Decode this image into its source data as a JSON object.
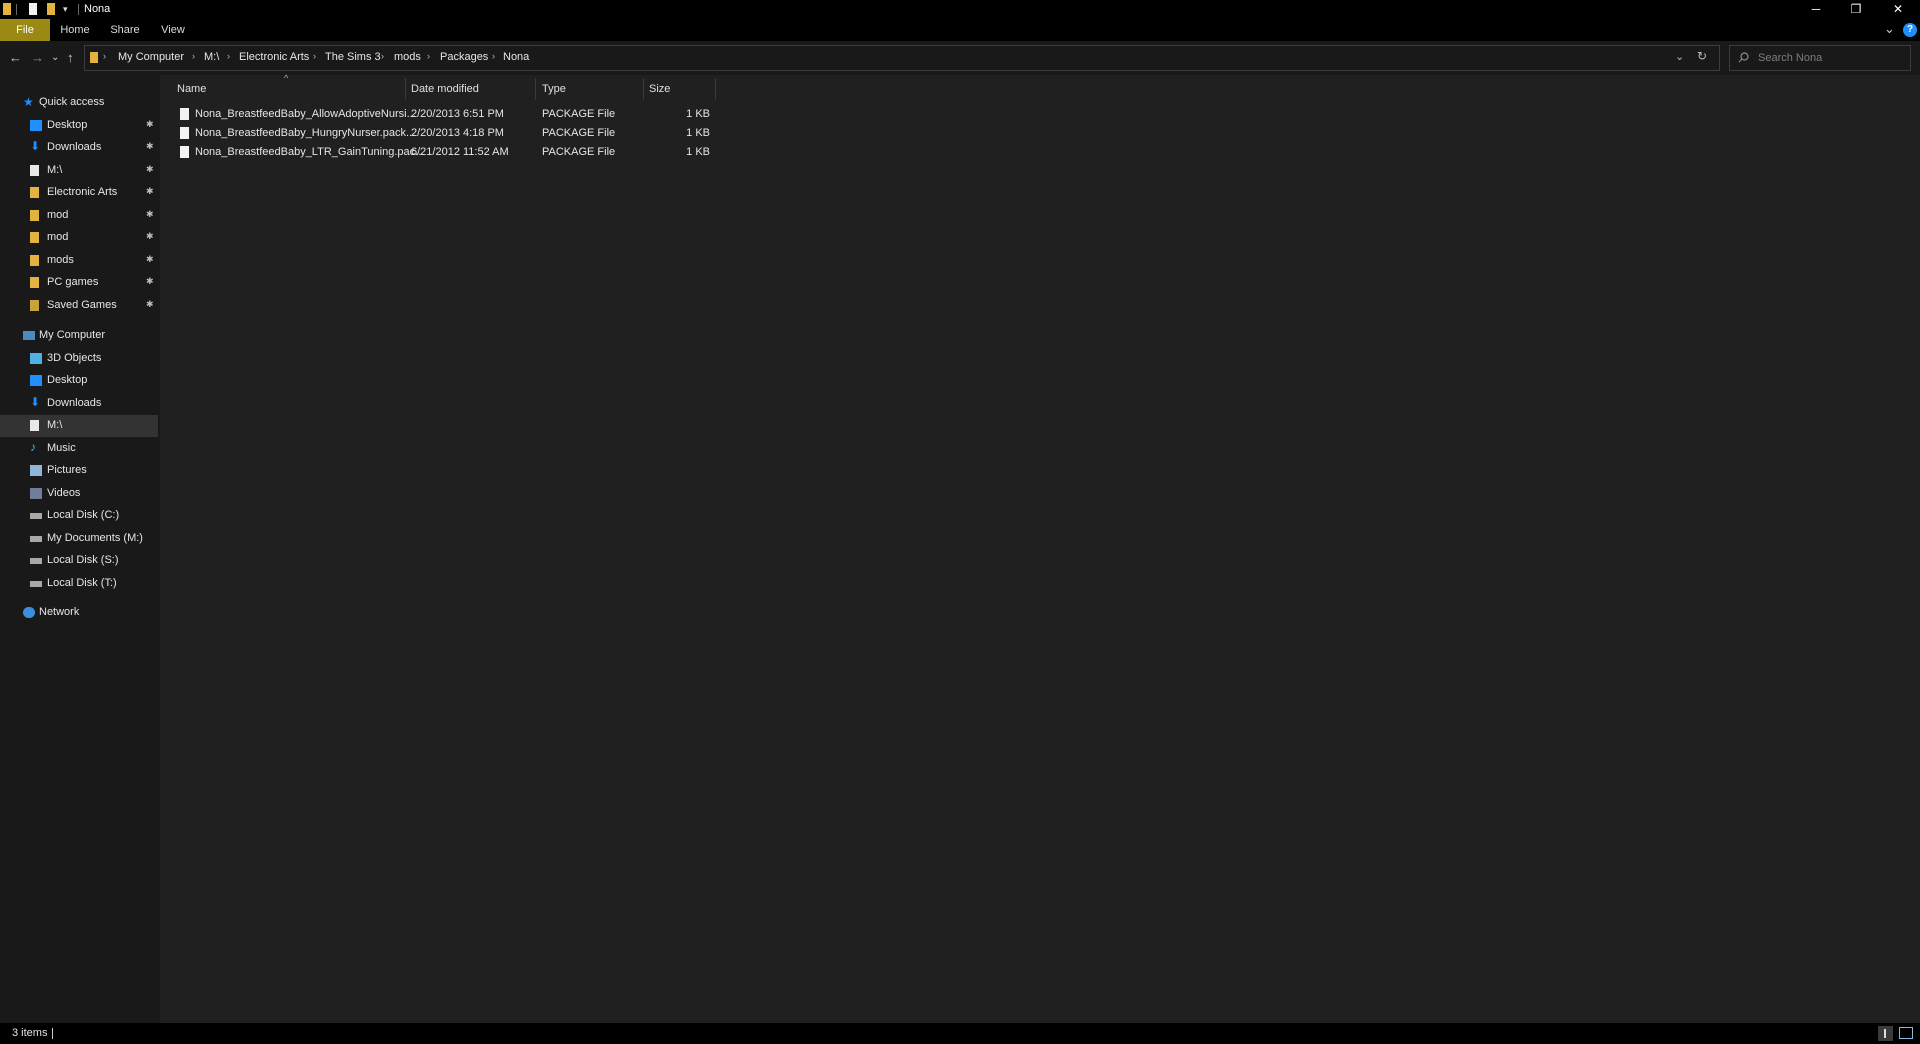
{
  "window": {
    "title": "Nona",
    "minimize": "─",
    "restore": "❐",
    "close": "✕"
  },
  "ribbon": {
    "tabs": [
      "File",
      "Home",
      "Share",
      "View"
    ],
    "help": "?",
    "expand": "⌄"
  },
  "nav_buttons": {
    "back": "←",
    "forward": "→",
    "recent": "⌄",
    "up": "↑",
    "address_dropdown": "⌄",
    "refresh": "↻"
  },
  "breadcrumb": [
    "My Computer",
    "M:\\",
    "Electronic Arts",
    "The Sims 3",
    "mods",
    "Packages",
    "Nona"
  ],
  "search": {
    "placeholder": "Search Nona"
  },
  "navpane": {
    "quick_access": {
      "label": "Quick access",
      "items": [
        {
          "label": "Desktop",
          "icon": "desktop-icon",
          "pinned": true
        },
        {
          "label": "Downloads",
          "icon": "download-icon",
          "pinned": true
        },
        {
          "label": "M:\\",
          "icon": "drive-doc-icon",
          "pinned": true
        },
        {
          "label": "Electronic Arts",
          "icon": "folder-icon",
          "pinned": true
        },
        {
          "label": "mod",
          "icon": "folder-icon",
          "pinned": true
        },
        {
          "label": "mod",
          "icon": "folder-icon",
          "pinned": true
        },
        {
          "label": "mods",
          "icon": "folder-icon",
          "pinned": true
        },
        {
          "label": "PC games",
          "icon": "folder-icon",
          "pinned": true
        },
        {
          "label": "Saved Games",
          "icon": "saved-games-icon",
          "pinned": true
        }
      ]
    },
    "my_computer": {
      "label": "My Computer",
      "items": [
        {
          "label": "3D Objects",
          "icon": "cube-icon"
        },
        {
          "label": "Desktop",
          "icon": "desktop-icon"
        },
        {
          "label": "Downloads",
          "icon": "download-icon"
        },
        {
          "label": "M:\\",
          "icon": "drive-doc-icon",
          "selected": true
        },
        {
          "label": "Music",
          "icon": "music-icon"
        },
        {
          "label": "Pictures",
          "icon": "pictures-icon"
        },
        {
          "label": "Videos",
          "icon": "videos-icon"
        },
        {
          "label": "Local Disk (C:)",
          "icon": "disk-icon"
        },
        {
          "label": "My Documents (M:)",
          "icon": "disk-icon"
        },
        {
          "label": "Local Disk (S:)",
          "icon": "disk-icon"
        },
        {
          "label": "Local Disk (T:)",
          "icon": "disk-icon"
        }
      ]
    },
    "network": {
      "label": "Network"
    },
    "pin_glyph": "📌"
  },
  "columns": [
    "Name",
    "Date modified",
    "Type",
    "Size"
  ],
  "sort_glyph": "^",
  "files": [
    {
      "name": "Nona_BreastfeedBaby_AllowAdoptiveNursi...",
      "date": "2/20/2013 6:51 PM",
      "type": "PACKAGE File",
      "size": "1 KB"
    },
    {
      "name": "Nona_BreastfeedBaby_HungryNurser.pack...",
      "date": "2/20/2013 4:18 PM",
      "type": "PACKAGE File",
      "size": "1 KB"
    },
    {
      "name": "Nona_BreastfeedBaby_LTR_GainTuning.pac...",
      "date": "6/21/2012 11:52 AM",
      "type": "PACKAGE File",
      "size": "1 KB"
    }
  ],
  "status": {
    "count": "3 items"
  },
  "colors": {
    "accent": "#9a8a13",
    "folder": "#e3b341",
    "blue": "#1f8fff"
  }
}
